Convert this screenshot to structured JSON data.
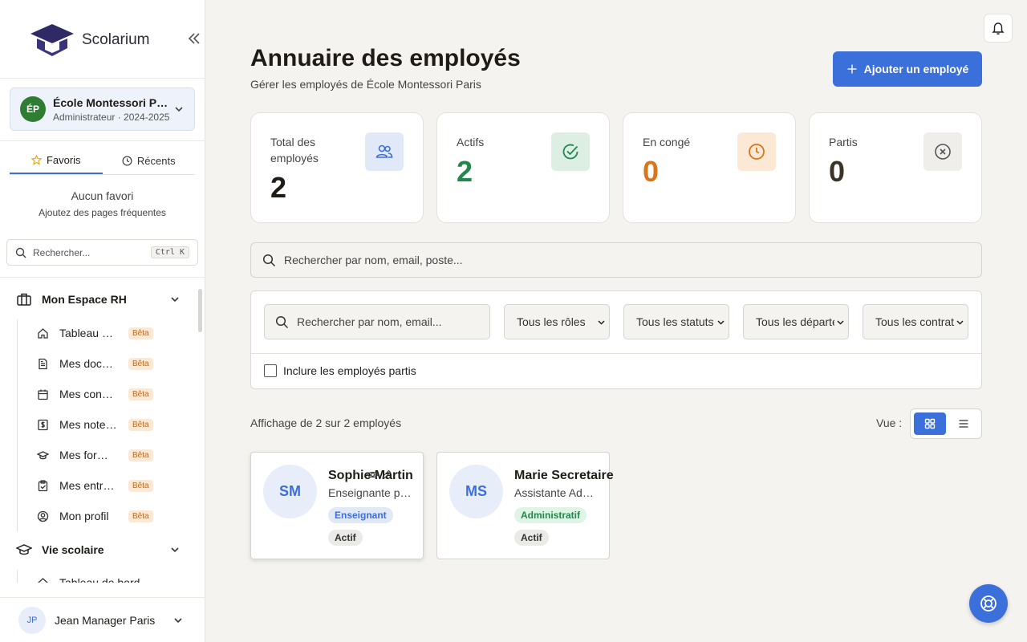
{
  "brand": {
    "name": "Scolarium"
  },
  "org": {
    "initials": "ÉP",
    "name": "École Montessori Paris",
    "role": "Administrateur · 2024-2025"
  },
  "favorites": {
    "tabs": [
      {
        "label": "Favoris",
        "icon": "star-icon"
      },
      {
        "label": "Récents",
        "icon": "clock-icon"
      }
    ],
    "empty_title": "Aucun favori",
    "empty_sub": "Ajoutez des pages fréquentes"
  },
  "sidebar_search": {
    "placeholder": "Rechercher...",
    "shortcut": "Ctrl K"
  },
  "nav": {
    "section1": {
      "label": "Mon Espace RH",
      "items": [
        {
          "label": "Tableau de bord",
          "badge": "Bêta",
          "icon": "home-icon"
        },
        {
          "label": "Mes documents",
          "badge": "Bêta",
          "icon": "document-icon"
        },
        {
          "label": "Mes congés",
          "badge": "Bêta",
          "icon": "calendar-icon"
        },
        {
          "label": "Mes notes de frais",
          "badge": "Bêta",
          "icon": "dollar-icon"
        },
        {
          "label": "Mes formations",
          "badge": "Bêta",
          "icon": "graduation-icon"
        },
        {
          "label": "Mes entretiens",
          "badge": "Bêta",
          "icon": "clipboard-icon"
        },
        {
          "label": "Mon profil",
          "badge": "Bêta",
          "icon": "user-circle-icon"
        }
      ]
    },
    "section2": {
      "label": "Vie scolaire",
      "first_item": "Tableau de bord"
    }
  },
  "user": {
    "initials": "JP",
    "name": "Jean Manager Paris"
  },
  "header": {
    "title": "Annuaire des employés",
    "subtitle": "Gérer les employés de École Montessori Paris",
    "add_button": "Ajouter un employé"
  },
  "stats": [
    {
      "label": "Total des employés",
      "value": "2",
      "color": "#1f1b16",
      "icon": "users-icon",
      "icon_bg": "#e1e9f8",
      "icon_color": "#3b6fd9"
    },
    {
      "label": "Actifs",
      "value": "2",
      "color": "#23864a",
      "icon": "check-circle-icon",
      "icon_bg": "#dcefe2",
      "icon_color": "#23864a"
    },
    {
      "label": "En congé",
      "value": "0",
      "color": "#d9751a",
      "icon": "clock-icon",
      "icon_bg": "#fbe8d5",
      "icon_color": "#d9751a"
    },
    {
      "label": "Partis",
      "value": "0",
      "color": "#3a3426",
      "icon": "x-circle-icon",
      "icon_bg": "#efeeea",
      "icon_color": "#555555"
    }
  ],
  "main_search": {
    "placeholder": "Rechercher par nom, email, poste..."
  },
  "filters": {
    "search_placeholder": "Rechercher par nom, email...",
    "roles": "Tous les rôles",
    "statuses": "Tous les statuts",
    "departments": "Tous les départements",
    "contracts": "Tous les contrats",
    "include_departed": "Inclure les employés partis"
  },
  "results": {
    "count_text": "Affichage de 2 sur 2 employés",
    "view_label": "Vue :"
  },
  "employees": [
    {
      "initials": "SM",
      "name": "Sophie Martin",
      "role": "Enseignante principale",
      "tag": "Enseignant",
      "status": "Actif"
    },
    {
      "initials": "MS",
      "name": "Marie Secretaire",
      "role": "Assistante Administrative",
      "tag": "Administratif",
      "status": "Actif"
    }
  ],
  "colors": {
    "accent": "#3b6fd9",
    "background": "#f4f3ef",
    "beta": "#c06a1a"
  }
}
